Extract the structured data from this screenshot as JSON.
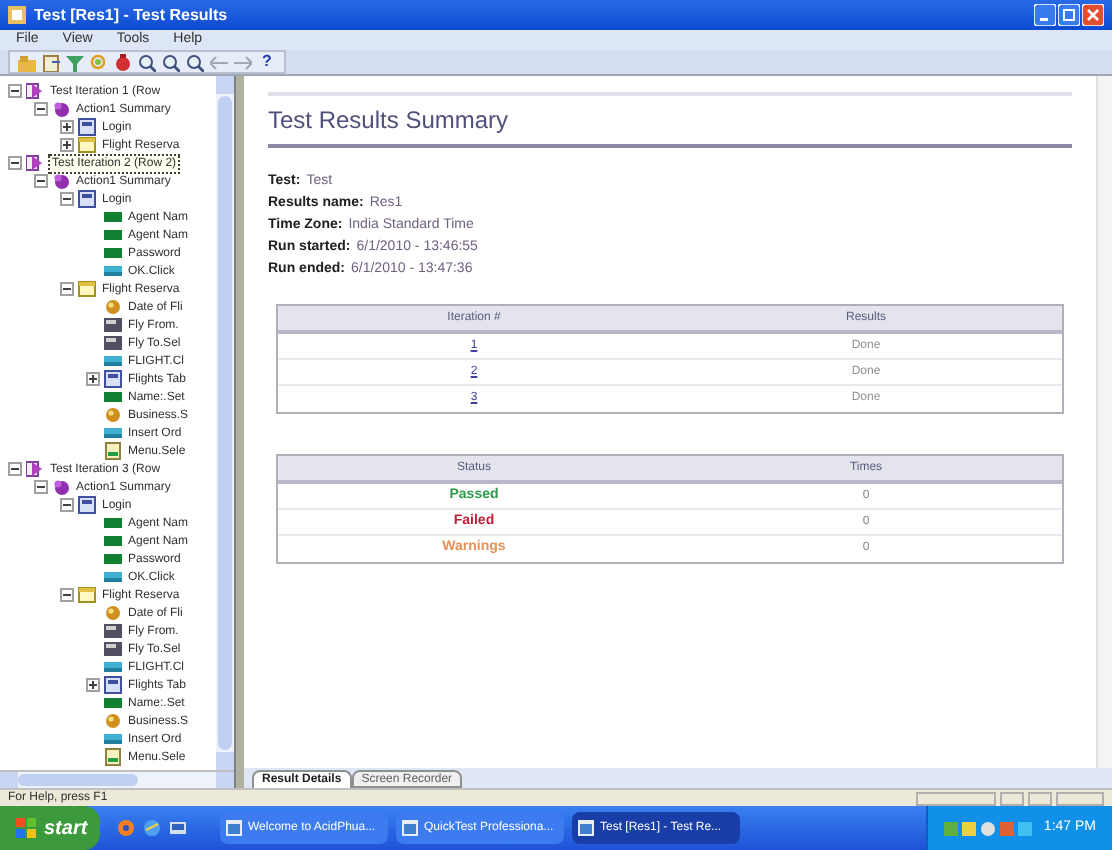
{
  "window": {
    "title": "Test [Res1] - Test Results"
  },
  "menu": [
    "File",
    "View",
    "Tools",
    "Help"
  ],
  "toolbar": [
    {
      "kind": "open"
    },
    {
      "kind": "export"
    },
    {
      "kind": "filter"
    },
    {
      "kind": "find"
    },
    {
      "kind": "bug"
    },
    {
      "kind": "zoom"
    },
    {
      "kind": "zoom"
    },
    {
      "kind": "zoom"
    },
    {
      "kind": "back"
    },
    {
      "kind": "forward"
    },
    {
      "kind": "help",
      "label": "?"
    }
  ],
  "tree": [
    {
      "label": "Test Iteration 1 (Row",
      "kind": "iteration",
      "expanded": true,
      "selected": false,
      "children": [
        {
          "label": "Action1 Summary",
          "kind": "action",
          "expanded": true,
          "children": [
            {
              "label": "Login",
              "kind": "page",
              "expanded": false
            },
            {
              "label": "Flight Reserva",
              "kind": "dialog",
              "expanded": false
            }
          ]
        }
      ]
    },
    {
      "label": "Test Iteration 2 (Row 2)",
      "kind": "iteration",
      "expanded": true,
      "selected": true,
      "children": [
        {
          "label": "Action1 Summary",
          "kind": "action",
          "expanded": true,
          "children": [
            {
              "label": "Login",
              "kind": "page",
              "expanded": true,
              "children": [
                {
                  "label": "Agent Nam",
                  "kind": "edit"
                },
                {
                  "label": "Agent Nam",
                  "kind": "edit"
                },
                {
                  "label": "Password",
                  "kind": "edit"
                },
                {
                  "label": "OK.Click",
                  "kind": "button"
                }
              ]
            },
            {
              "label": "Flight Reserva",
              "kind": "dialog",
              "expanded": true,
              "children": [
                {
                  "label": "Date of Fli",
                  "kind": "ball"
                },
                {
                  "label": "Fly From.",
                  "kind": "combo"
                },
                {
                  "label": "Fly To.Sel",
                  "kind": "combo"
                },
                {
                  "label": "FLIGHT.Cl",
                  "kind": "button"
                },
                {
                  "label": "Flights Tab",
                  "kind": "page",
                  "expanded": false
                },
                {
                  "label": "Name:.Set",
                  "kind": "edit"
                },
                {
                  "label": "Business.S",
                  "kind": "ball"
                },
                {
                  "label": "Insert Ord",
                  "kind": "button"
                },
                {
                  "label": "Menu.Sele",
                  "kind": "menu"
                }
              ]
            }
          ]
        }
      ]
    },
    {
      "label": "Test Iteration 3 (Row",
      "kind": "iteration",
      "expanded": true,
      "selected": false,
      "children": [
        {
          "label": "Action1 Summary",
          "kind": "action",
          "expanded": true,
          "children": [
            {
              "label": "Login",
              "kind": "page",
              "expanded": true,
              "children": [
                {
                  "label": "Agent Nam",
                  "kind": "edit"
                },
                {
                  "label": "Agent Nam",
                  "kind": "edit"
                },
                {
                  "label": "Password",
                  "kind": "edit"
                },
                {
                  "label": "OK.Click",
                  "kind": "button"
                }
              ]
            },
            {
              "label": "Flight Reserva",
              "kind": "dialog",
              "expanded": true,
              "children": [
                {
                  "label": "Date of Fli",
                  "kind": "ball"
                },
                {
                  "label": "Fly From.",
                  "kind": "combo"
                },
                {
                  "label": "Fly To.Sel",
                  "kind": "combo"
                },
                {
                  "label": "FLIGHT.Cl",
                  "kind": "button"
                },
                {
                  "label": "Flights Tab",
                  "kind": "page",
                  "expanded": false
                },
                {
                  "label": "Name:.Set",
                  "kind": "edit"
                },
                {
                  "label": "Business.S",
                  "kind": "ball"
                },
                {
                  "label": "Insert Ord",
                  "kind": "button"
                },
                {
                  "label": "Menu.Sele",
                  "kind": "menu"
                }
              ]
            }
          ]
        }
      ]
    }
  ],
  "summary": {
    "title": "Test Results Summary",
    "fields": [
      {
        "label": "Test:",
        "value": "Test"
      },
      {
        "label": "Results name:",
        "value": "Res1"
      },
      {
        "label": "Time Zone:",
        "value": "India Standard Time"
      },
      {
        "label": "Run started:",
        "value": "6/1/2010 - 13:46:55"
      },
      {
        "label": "Run ended:",
        "value": "6/1/2010 - 13:47:36"
      }
    ],
    "iterations": {
      "columns": [
        "Iteration #",
        "Results"
      ],
      "rows": [
        {
          "number": "1",
          "result": "Done"
        },
        {
          "number": "2",
          "result": "Done"
        },
        {
          "number": "3",
          "result": "Done"
        }
      ]
    },
    "statuses": {
      "columns": [
        "Status",
        "Times"
      ],
      "rows": [
        {
          "status": "Passed",
          "color": "#2e9a4a",
          "times": "0"
        },
        {
          "status": "Failed",
          "color": "#c0203a",
          "times": "0"
        },
        {
          "status": "Warnings",
          "color": "#e8905a",
          "times": "0"
        }
      ]
    }
  },
  "tabs": [
    {
      "label": "Result Details",
      "selected": true
    },
    {
      "label": "Screen Recorder",
      "selected": false
    }
  ],
  "status_bar": "For Help, press F1",
  "taskbar": {
    "start": "start",
    "quick_launch": [
      {
        "kind": "media"
      },
      {
        "kind": "browser"
      },
      {
        "kind": "desktop"
      }
    ],
    "tasks": [
      {
        "label": "Welcome to AcidPhua...",
        "selected": false
      },
      {
        "label": "QuickTest Professiona...",
        "selected": false
      },
      {
        "label": "Test [Res1] - Test Re...",
        "selected": true
      }
    ],
    "clock": "1:47 PM"
  }
}
